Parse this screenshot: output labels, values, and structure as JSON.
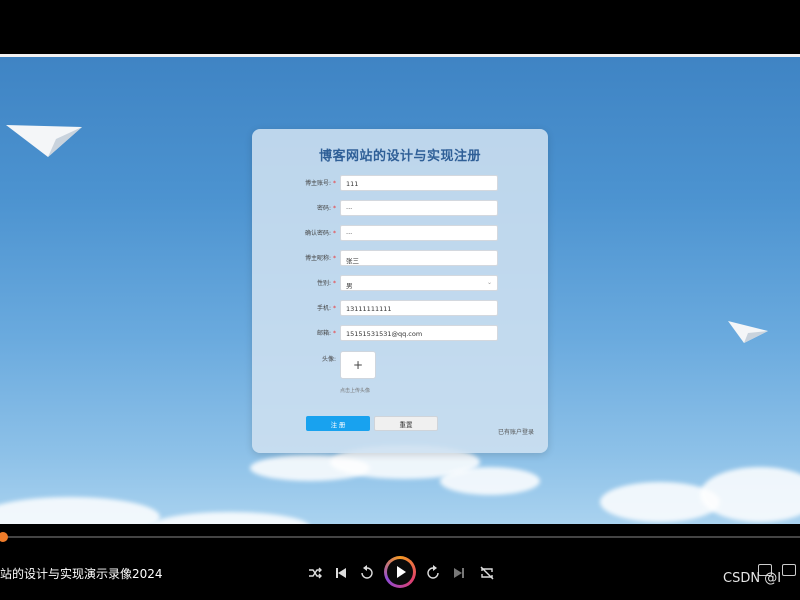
{
  "form": {
    "title": "博客网站的设计与实现注册",
    "fields": [
      {
        "label": "博主账号:",
        "value": "111"
      },
      {
        "label": "密码:",
        "value": "···"
      },
      {
        "label": "确认密码:",
        "value": "···"
      },
      {
        "label": "博主昵称:",
        "value": "张三"
      },
      {
        "label": "性别:",
        "value": "男"
      },
      {
        "label": "手机:",
        "value": "13111111111"
      },
      {
        "label": "邮箱:",
        "value": "15151531531@qq.com"
      }
    ],
    "required_mark": "*",
    "avatar_label": "头像:",
    "avatar_plus": "+",
    "upload_hint": "点击上传头像",
    "register_button": "注 册",
    "reset_button": "重置",
    "login_link": "已有账户登录",
    "chevron": "⌄"
  },
  "player": {
    "title": "站的设计与实现演示录像2024",
    "progress": 0.0,
    "icons": [
      "shuffle-icon",
      "skip-back-icon",
      "rewind-icon",
      "play-icon",
      "forward-icon",
      "skip-forward-icon",
      "loop-icon"
    ],
    "watermark": "CSDN @I"
  },
  "colors": {
    "accent": "#18a2ef",
    "title": "#2f5f97",
    "progress": "#ef7c2a"
  }
}
